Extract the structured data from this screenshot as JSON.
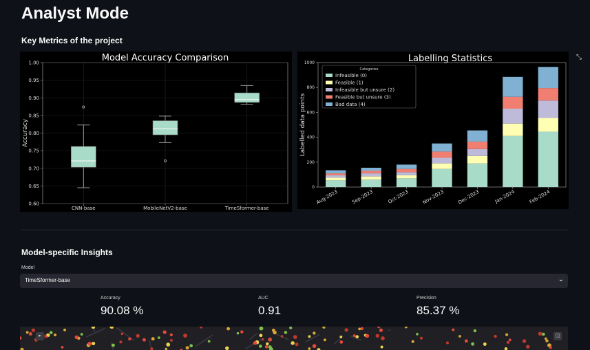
{
  "page": {
    "title": "Analyst Mode",
    "key_metrics_heading": "Key Metrics of the project",
    "insights_heading": "Model-specific Insights"
  },
  "icons": {
    "fullscreen": "expand-icon",
    "dropdown": "chevron-down-icon",
    "map_layers": "layers-icon",
    "map_view": "square-icon"
  },
  "model_select": {
    "label": "Model",
    "value": "TimeSformer-base"
  },
  "metrics": [
    {
      "label": "Accuracy",
      "value": "90.08 %"
    },
    {
      "label": "AUC",
      "value": "0.91"
    },
    {
      "label": "Precision",
      "value": "85.37 %"
    }
  ],
  "chart_data": [
    {
      "type": "box",
      "title": "Model Accuracy Comparison",
      "xlabel": "",
      "ylabel": "Accuracy",
      "ylim": [
        0.6,
        1.0
      ],
      "yticks": [
        "0.60",
        "0.65",
        "0.70",
        "0.75",
        "0.80",
        "0.85",
        "0.90",
        "0.95",
        "1.00"
      ],
      "categories": [
        "CNN-base",
        "MobileNetV2-base",
        "TimeSformer-base"
      ],
      "boxes": [
        {
          "min": 0.645,
          "q1": 0.703,
          "median": 0.721,
          "q3": 0.762,
          "max": 0.823,
          "outliers": [
            0.874
          ]
        },
        {
          "min": 0.773,
          "q1": 0.795,
          "median": 0.812,
          "q3": 0.835,
          "max": 0.848,
          "outliers": [
            0.721
          ]
        },
        {
          "min": 0.882,
          "q1": 0.887,
          "median": 0.895,
          "q3": 0.914,
          "max": 0.935,
          "outliers": []
        }
      ],
      "colors": {
        "box": "#a8dcc8",
        "whisker": "#9a9a9a",
        "median": "#ffffff"
      }
    },
    {
      "type": "bar",
      "stacked": true,
      "title": "Labelling Statistics",
      "xlabel": "",
      "ylabel": "Labelled data points",
      "ylim": [
        0,
        1000
      ],
      "yticks": [
        "0",
        "200",
        "400",
        "600",
        "800",
        "1000"
      ],
      "categories": [
        "Aug-2023",
        "Sep-2023",
        "Oct-2023",
        "Nov-2023",
        "Dec-2023",
        "Jan-2024",
        "Feb-2024"
      ],
      "legend_title": "Categories",
      "legend_position": "top-left",
      "series": [
        {
          "name": "Infeasible (0)",
          "color": "#a8dcc8",
          "values": [
            55,
            60,
            70,
            145,
            190,
            410,
            445
          ]
        },
        {
          "name": "Feasible (1)",
          "color": "#ffffb3",
          "values": [
            20,
            25,
            25,
            45,
            60,
            100,
            110
          ]
        },
        {
          "name": "Infeasible but unsure (2)",
          "color": "#bebada",
          "values": [
            20,
            25,
            25,
            45,
            55,
            120,
            140
          ]
        },
        {
          "name": "Feasible but unsure (3)",
          "color": "#f07f72",
          "values": [
            15,
            20,
            25,
            50,
            60,
            95,
            100
          ]
        },
        {
          "name": "Bad data (4)",
          "color": "#80b1d3",
          "values": [
            25,
            25,
            35,
            65,
            90,
            160,
            170
          ]
        }
      ]
    }
  ]
}
